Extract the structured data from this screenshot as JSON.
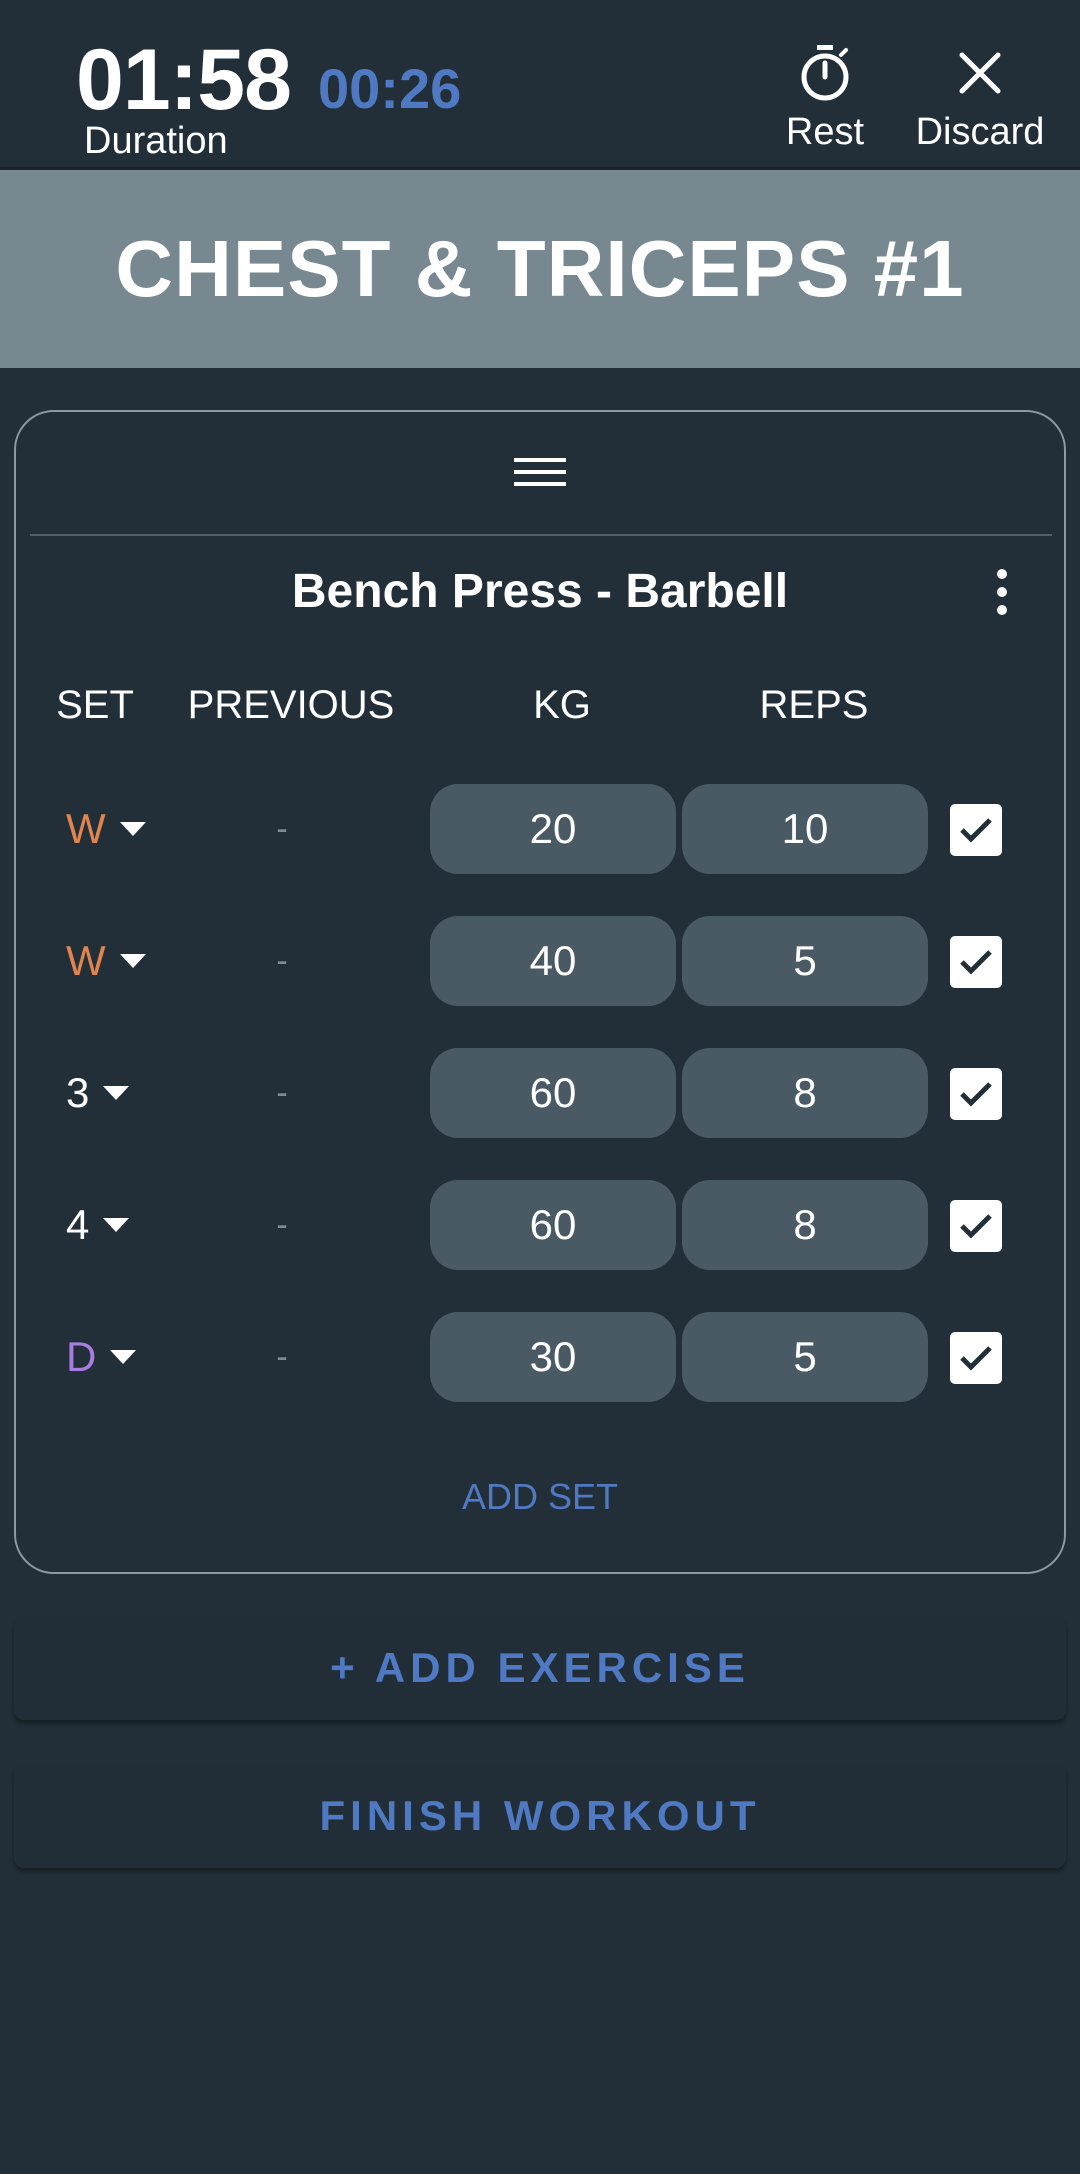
{
  "topbar": {
    "elapsed": "01:58",
    "rest_timer": "00:26",
    "duration_label": "Duration",
    "rest_label": "Rest",
    "rest_icon": "stopwatch-icon",
    "discard_label": "Discard",
    "discard_icon": "close-icon"
  },
  "workout": {
    "title": "CHEST & TRICEPS #1"
  },
  "exercise": {
    "name": "Bench Press - Barbell",
    "drag_icon": "drag-handle-icon",
    "menu_icon": "more-vert-icon",
    "columns": {
      "set": "SET",
      "previous": "PREVIOUS",
      "kg": "KG",
      "reps": "REPS"
    },
    "sets": [
      {
        "type": "W",
        "type_color": "#e0854d",
        "previous": "-",
        "kg": "20",
        "reps": "10",
        "done": true
      },
      {
        "type": "W",
        "type_color": "#e0854d",
        "previous": "-",
        "kg": "40",
        "reps": "5",
        "done": true
      },
      {
        "type": "3",
        "type_color": "#ffffff",
        "previous": "-",
        "kg": "60",
        "reps": "8",
        "done": true
      },
      {
        "type": "4",
        "type_color": "#ffffff",
        "previous": "-",
        "kg": "60",
        "reps": "8",
        "done": true
      },
      {
        "type": "D",
        "type_color": "#a77de0",
        "previous": "-",
        "kg": "30",
        "reps": "5",
        "done": true
      }
    ],
    "add_set_label": "ADD SET"
  },
  "actions": {
    "add_exercise_label": "+ ADD EXERCISE",
    "finish_label": "FINISH WORKOUT"
  },
  "colors": {
    "background": "#222f38",
    "banner": "#788891",
    "accent": "#4f79c2",
    "warmup": "#e0854d",
    "dropset": "#a77de0",
    "input_pill": "#4a5a65"
  }
}
